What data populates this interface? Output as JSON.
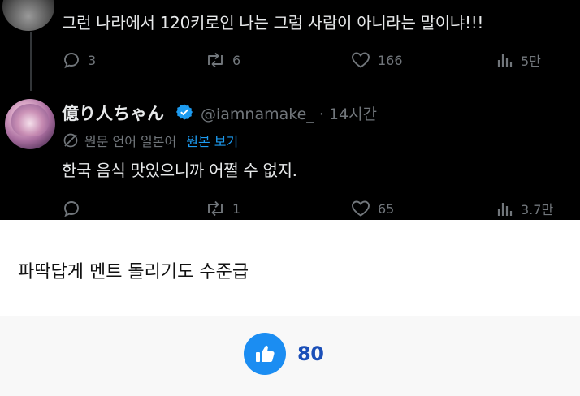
{
  "tweet_top": {
    "text": "그런 나라에서 120키로인 나는 그럼 사람이 아니라는 말이냐!!!",
    "replies": "3",
    "reposts": "6",
    "likes": "166",
    "views": "5만"
  },
  "tweet_reply": {
    "display_name": "億り人ちゃん",
    "handle_time": "@iamnamake_ · 14시간",
    "translate_note": "원문 언어 일본어",
    "show_original_label": "원본 보기",
    "text": "한국 음식 맛있으니까 어쩔 수 없지.",
    "replies": "",
    "reposts": "1",
    "likes": "65",
    "views": "3.7만"
  },
  "article": {
    "caption": "파딱답게 멘트 돌리기도 수준급",
    "like_count": "80"
  },
  "colors": {
    "tweet_bg": "#000000",
    "tweet_text": "#e7e9ea",
    "tweet_muted": "#71767b",
    "link_blue": "#1d9bf0",
    "like_button": "#1b8df2",
    "like_count": "#1b4fb8"
  },
  "icons": {
    "reply": "speech-bubble-icon",
    "repost": "repost-arrows-icon",
    "like": "heart-icon",
    "views": "bar-chart-icon",
    "verified": "verified-badge-icon",
    "translate": "translate-globe-icon",
    "thumbs_up": "thumbs-up-icon"
  }
}
